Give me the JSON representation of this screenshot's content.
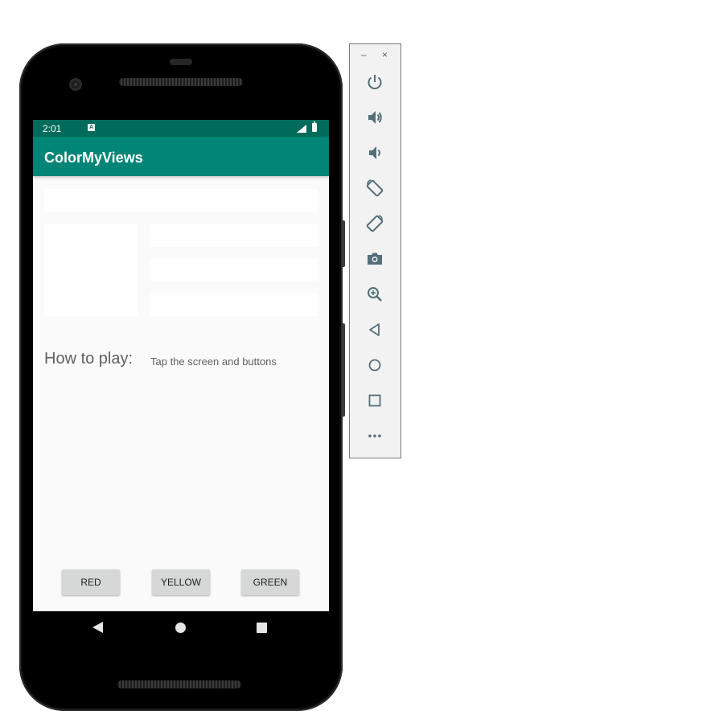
{
  "status_bar": {
    "time": "2:01",
    "notification_badge": "A"
  },
  "app_bar": {
    "title": "ColorMyViews"
  },
  "content": {
    "label_title": "How to play:",
    "label_info": "Tap the screen and buttons"
  },
  "buttons": {
    "red": "RED",
    "yellow": "YELLOW",
    "green": "GREEN"
  },
  "toolbar": {
    "minimize": "–",
    "close": "×",
    "items": [
      "power-icon",
      "volume-up-icon",
      "volume-down-icon",
      "rotate-left-icon",
      "rotate-right-icon",
      "camera-icon",
      "zoom-icon",
      "back-icon",
      "home-icon",
      "overview-icon",
      "more-icon"
    ]
  },
  "colors": {
    "status_bar": "#006b5a",
    "app_bar": "#008577",
    "screen_bg": "#fafafa",
    "button_bg": "#d6d7d7",
    "toolbar_icon": "#546e7a"
  }
}
